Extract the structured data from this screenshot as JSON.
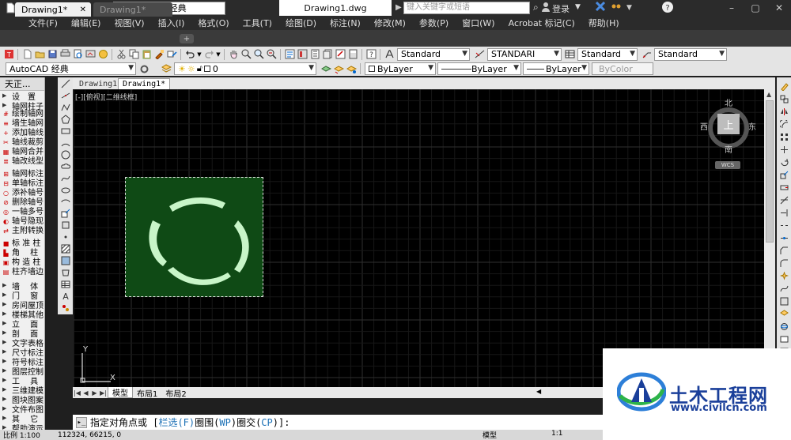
{
  "title_bar": {
    "workspace": "AutoCAD 经典",
    "doc_title": "Drawing1.dwg",
    "search_placeholder": "键入关键字或短语",
    "login": "登录"
  },
  "menu": [
    "文件(F)",
    "编辑(E)",
    "视图(V)",
    "插入(I)",
    "格式(O)",
    "工具(T)",
    "绘图(D)",
    "标注(N)",
    "修改(M)",
    "参数(P)",
    "窗口(W)",
    "Acrobat 标记(C)",
    "帮助(H)"
  ],
  "doc_tabs": [
    {
      "label": "Drawing1*",
      "active": true
    },
    {
      "label": "Drawing1*",
      "active": false
    }
  ],
  "toolbar1": {
    "text_style": "Standard",
    "dim_style": "STANDARI",
    "table_style": "Standard",
    "mleader_style": "Standard"
  },
  "toolbar2": {
    "workspace": "AutoCAD 经典",
    "layer": "0",
    "color": "ByLayer",
    "linetype": "ByLayer",
    "lineweight": "ByLayer",
    "plotstyle": "ByColor"
  },
  "palette": {
    "title": "天正...",
    "items": [
      {
        "type": "sect",
        "label": "设　置"
      },
      {
        "type": "sect",
        "label": "轴网柱子"
      },
      {
        "type": "item",
        "label": "绘制轴网",
        "glyph": "#"
      },
      {
        "type": "item",
        "label": "墙生轴网",
        "glyph": "≡"
      },
      {
        "type": "item",
        "label": "添加轴线",
        "glyph": "+"
      },
      {
        "type": "item",
        "label": "轴线裁剪",
        "glyph": "✂"
      },
      {
        "type": "item",
        "label": "轴网合并",
        "glyph": "▦"
      },
      {
        "type": "item",
        "label": "轴改线型",
        "glyph": "≣"
      },
      {
        "type": "gap"
      },
      {
        "type": "item",
        "label": "轴网标注",
        "glyph": "⊞"
      },
      {
        "type": "item",
        "label": "单轴标注",
        "glyph": "⊟"
      },
      {
        "type": "item",
        "label": "添补轴号",
        "glyph": "○"
      },
      {
        "type": "item",
        "label": "删除轴号",
        "glyph": "⊘"
      },
      {
        "type": "item",
        "label": "一轴多号",
        "glyph": "◎"
      },
      {
        "type": "item",
        "label": "轴号隐现",
        "glyph": "◐"
      },
      {
        "type": "item",
        "label": "主附转换",
        "glyph": "⇄"
      },
      {
        "type": "gap"
      },
      {
        "type": "item",
        "label": "标 准 柱",
        "glyph": "■"
      },
      {
        "type": "item",
        "label": "角　 柱",
        "glyph": "▙"
      },
      {
        "type": "item",
        "label": "构 造 柱",
        "glyph": "▣"
      },
      {
        "type": "item",
        "label": "柱齐墙边",
        "glyph": "▤"
      },
      {
        "type": "gap"
      },
      {
        "type": "sect",
        "label": "墙　 体"
      },
      {
        "type": "sect",
        "label": "门　 窗"
      },
      {
        "type": "sect",
        "label": "房间屋顶"
      },
      {
        "type": "sect",
        "label": "楼梯其他"
      },
      {
        "type": "sect",
        "label": "立　 面"
      },
      {
        "type": "sect",
        "label": "剖　 面"
      },
      {
        "type": "sect",
        "label": "文字表格"
      },
      {
        "type": "sect",
        "label": "尺寸标注"
      },
      {
        "type": "sect",
        "label": "符号标注"
      },
      {
        "type": "sect",
        "label": "图层控制"
      },
      {
        "type": "sect",
        "label": "工　 具"
      },
      {
        "type": "sect",
        "label": "三维建模"
      },
      {
        "type": "sect",
        "label": "图块图案"
      },
      {
        "type": "sect",
        "label": "文件布图"
      },
      {
        "type": "sect",
        "label": "其　 它"
      },
      {
        "type": "sect",
        "label": "帮助演示"
      }
    ]
  },
  "layout_tabs_top": [
    "Drawing1",
    "Drawing1*"
  ],
  "viewport_label": "[-][俯视][二维线框]",
  "viewcube": {
    "north": "北",
    "south": "南",
    "east": "东",
    "west": "西",
    "face": "上",
    "wcs": "WCS"
  },
  "ucs": {
    "x": "X",
    "y": "Y"
  },
  "layout_tabs": [
    "模型",
    "布局1",
    "布局2"
  ],
  "command": {
    "prefix": "指定对角点或 [",
    "opt1": "栏选(F)",
    "opt2_a": "圈围(",
    "opt2_k": "WP",
    "opt2_b": ")",
    "opt3_a": "圈交(",
    "opt3_k": "CP",
    "opt3_b": ")",
    "suffix": "]:"
  },
  "status": {
    "scale": "比例 1:100",
    "coords": "112324, 66215, 0",
    "model": "模型",
    "anno_scale": "1:1"
  },
  "watermark": {
    "title": "土木工程网",
    "url": "www.civilcn.com"
  },
  "colors": {
    "canvas": "#000000",
    "selection_fill": "#0f4a15",
    "arc_fill": "#c8f5c8",
    "brand_blue": "#1a3f9a",
    "keyword": "#1a6fb5"
  }
}
